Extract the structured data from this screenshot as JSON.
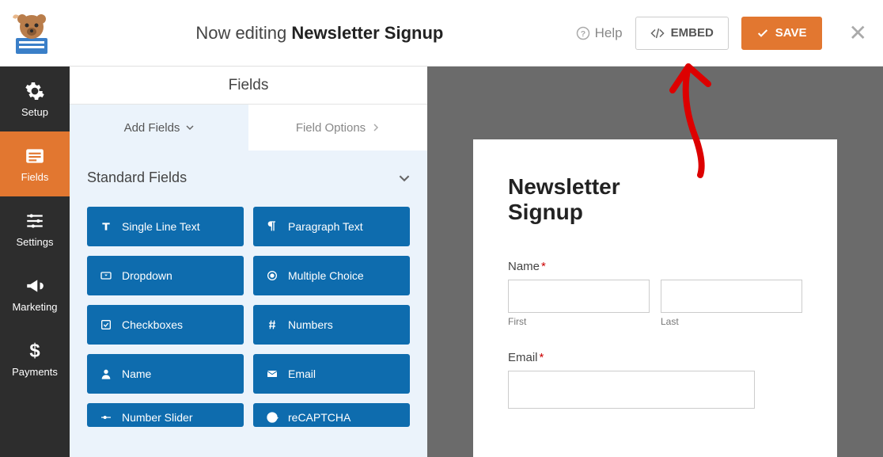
{
  "header": {
    "editing_prefix": "Now editing",
    "form_name": "Newsletter Signup",
    "help_label": "Help",
    "embed_label": "EMBED",
    "save_label": "SAVE"
  },
  "sidebar": {
    "items": [
      {
        "label": "Setup"
      },
      {
        "label": "Fields"
      },
      {
        "label": "Settings"
      },
      {
        "label": "Marketing"
      },
      {
        "label": "Payments"
      }
    ]
  },
  "panel": {
    "title": "Fields",
    "tabs": {
      "add": "Add Fields",
      "options": "Field Options"
    },
    "group": "Standard Fields",
    "fields": [
      {
        "label": "Single Line Text"
      },
      {
        "label": "Paragraph Text"
      },
      {
        "label": "Dropdown"
      },
      {
        "label": "Multiple Choice"
      },
      {
        "label": "Checkboxes"
      },
      {
        "label": "Numbers"
      },
      {
        "label": "Name"
      },
      {
        "label": "Email"
      },
      {
        "label": "Number Slider"
      },
      {
        "label": "reCAPTCHA"
      }
    ]
  },
  "preview": {
    "form_title": "Newsletter Signup",
    "name_label": "Name",
    "first_label": "First",
    "last_label": "Last",
    "email_label": "Email",
    "required_marker": "*"
  }
}
